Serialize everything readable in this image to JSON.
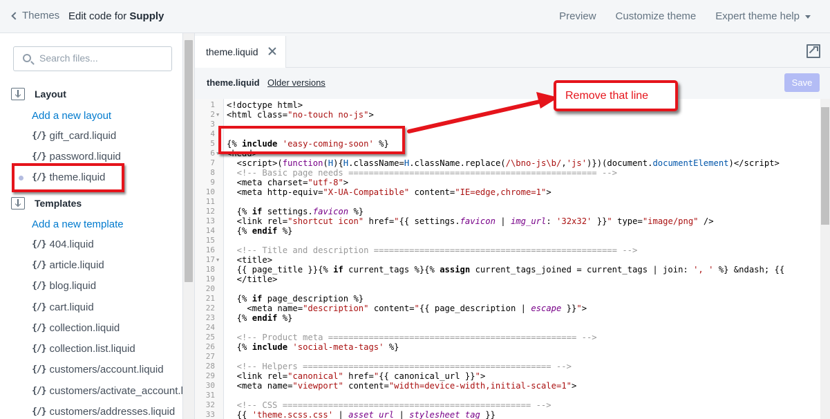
{
  "topbar": {
    "back_label": "Themes",
    "title_prefix": "Edit code for ",
    "theme_name": "Supply",
    "actions": [
      "Preview",
      "Customize theme",
      "Expert theme help"
    ]
  },
  "sidebar": {
    "search_placeholder": "Search files...",
    "layout_folder": "Layout",
    "layout_add": "Add a new layout",
    "layout_files": [
      "gift_card.liquid",
      "password.liquid",
      "theme.liquid"
    ],
    "templates_folder": "Templates",
    "templates_add": "Add a new template",
    "template_files": [
      "404.liquid",
      "article.liquid",
      "blog.liquid",
      "cart.liquid",
      "collection.liquid",
      "collection.list.liquid",
      "customers/account.liquid",
      "customers/activate_account.li",
      "customers/addresses.liquid"
    ],
    "file_icon_glyph": "{/}"
  },
  "editor": {
    "tab_label": "theme.liquid",
    "file_name": "theme.liquid",
    "older_versions": "Older versions",
    "save_label": "Save",
    "line_numbers": [
      "1",
      "2",
      "3",
      "4",
      "5",
      "6",
      "7",
      "8",
      "9",
      "10",
      "11",
      "12",
      "13",
      "14",
      "15",
      "16",
      "17",
      "18",
      "19",
      "20",
      "21",
      "22",
      "23",
      "24",
      "25",
      "26",
      "27",
      "28",
      "29",
      "30",
      "31",
      "32",
      "33"
    ]
  },
  "annotation": {
    "callout_text": "Remove that line",
    "color": "#e5141b"
  },
  "colors": {
    "link": "#007ace",
    "save_disabled": "#b3bcf5"
  }
}
